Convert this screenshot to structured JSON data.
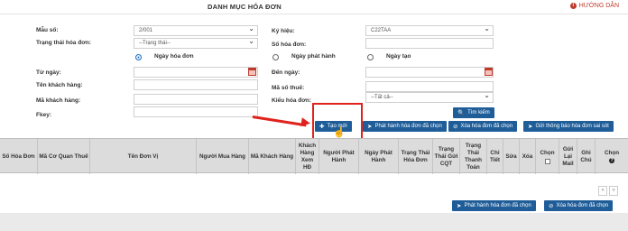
{
  "header": {
    "title": "DANH MỤC HÓA ĐƠN",
    "help": "HƯỚNG DẪN"
  },
  "form": {
    "mau_so": {
      "label": "Mẫu số:",
      "value": "2/001"
    },
    "trang_thai": {
      "label": "Trạng thái hóa đơn:",
      "value": "--Trạng thái--"
    },
    "ky_hieu": {
      "label": "Ký hiệu:",
      "value": "C22TAA"
    },
    "so_hoa_don": {
      "label": "Số hóa đơn:",
      "value": ""
    },
    "radios": [
      "Ngày hóa đơn",
      "Ngày phát hành",
      "Ngày tạo"
    ],
    "tu_ngay": {
      "label": "Từ ngày:"
    },
    "den_ngay": {
      "label": "Đến ngày:"
    },
    "ten_khach_hang": {
      "label": "Tên khách hàng:"
    },
    "ma_so_thue": {
      "label": "Mã số thuế:"
    },
    "ma_khach_hang": {
      "label": "Mã khách hàng:"
    },
    "kieu_hoa_don": {
      "label": "Kiểu hóa đơn:",
      "value": "--Tất cả--"
    },
    "fkey": {
      "label": "Fkey:"
    }
  },
  "buttons": {
    "search": "Tìm kiếm",
    "add_new": "Tạo mới",
    "publish_selected": "Phát hành hóa đơn đã chọn",
    "delete_selected": "Xóa hóa đơn đã chọn",
    "send_error_notice": "Gửi thông báo hóa đơn sai sót"
  },
  "table": {
    "columns": [
      "Số Hóa Đơn",
      "Mã Cơ Quan Thuế",
      "Tên Đơn Vị",
      "Người Mua Hàng",
      "Mã Khách Hàng",
      "Khách Hàng Xem HĐ",
      "Người Phát Hành",
      "Ngày Phát Hành",
      "Trạng Thái Hóa Đơn",
      "Trạng Thái Gửi CQT",
      "Trạng Thái Thanh Toán",
      "Chi Tiết",
      "Sửa",
      "Xóa",
      "Chọn",
      "Gửi Lại Mail",
      "Ghi Chú",
      "Chọn"
    ]
  },
  "pager": {
    "prev": "«",
    "next": "»"
  },
  "colors": {
    "primary_button": "#1f5d99",
    "highlight": "#e0221c",
    "help": "#c0392b"
  }
}
